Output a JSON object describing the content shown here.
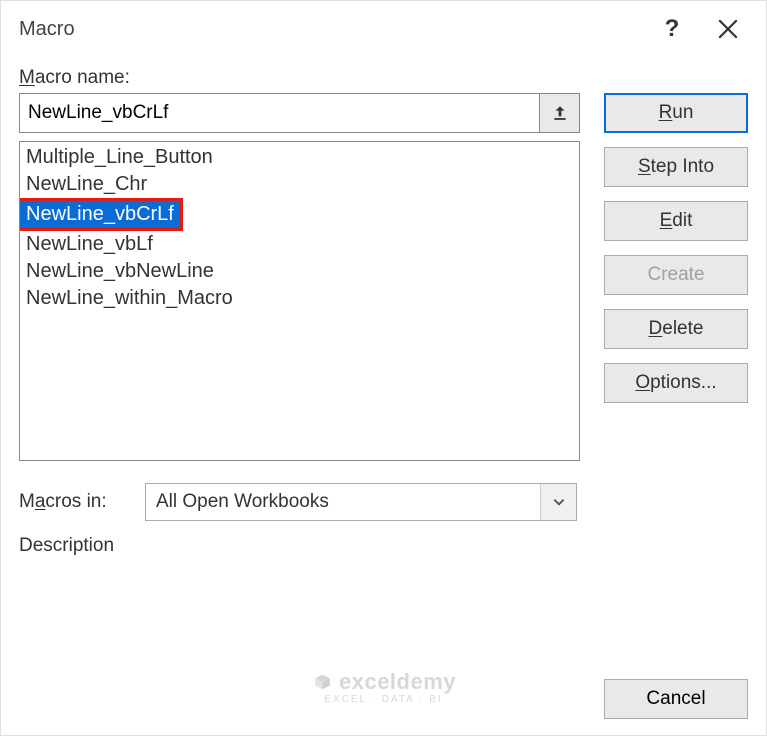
{
  "dialog": {
    "title": "Macro"
  },
  "labels": {
    "macro_name_prefix": "M",
    "macro_name_rest": "acro name:",
    "macros_in_prefix": "M",
    "macros_in_underlined": "a",
    "macros_in_rest": "cros in:",
    "description": "Description"
  },
  "macro_name_value": "NewLine_vbCrLf",
  "macro_list": [
    {
      "name": "Multiple_Line_Button",
      "selected": false
    },
    {
      "name": "NewLine_Chr",
      "selected": false
    },
    {
      "name": "NewLine_vbCrLf",
      "selected": true
    },
    {
      "name": "NewLine_vbLf",
      "selected": false
    },
    {
      "name": "NewLine_vbNewLine",
      "selected": false
    },
    {
      "name": "NewLine_within_Macro",
      "selected": false
    }
  ],
  "macros_in_value": "All Open Workbooks",
  "buttons": {
    "run_u": "R",
    "run_rest": "un",
    "step_u": "S",
    "step_rest": "tep Into",
    "edit_u": "E",
    "edit_rest": "dit",
    "create": "Create",
    "delete_u": "D",
    "delete_rest": "elete",
    "options_u": "O",
    "options_rest": "ptions...",
    "cancel": "Cancel"
  },
  "watermark": {
    "title": "exceldemy",
    "sub": "EXCEL · DATA · BI"
  }
}
